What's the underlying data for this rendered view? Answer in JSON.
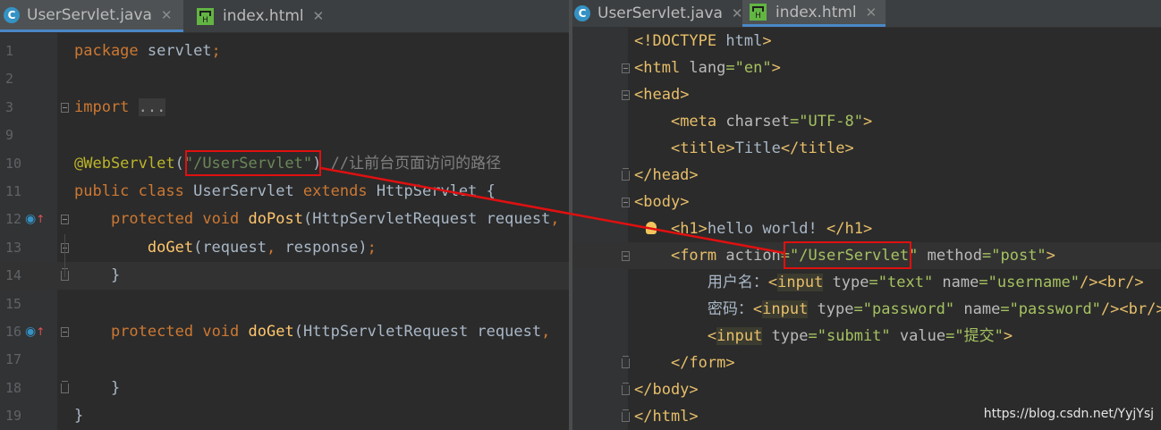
{
  "left": {
    "tabs": [
      {
        "label": "UserServlet.java",
        "icon": "java-class-icon",
        "active": true
      },
      {
        "label": "index.html",
        "icon": "html-file-icon",
        "active": false
      }
    ],
    "lines": [
      {
        "n": "1",
        "code": "package servlet;"
      },
      {
        "n": "2",
        "code": ""
      },
      {
        "n": "3",
        "code": "import ..."
      },
      {
        "n": "9",
        "code": ""
      },
      {
        "n": "10",
        "code": "@WebServlet(\"/UserServlet\") //让前台页面访问的路径"
      },
      {
        "n": "11",
        "code": "public class UserServlet extends HttpServlet {"
      },
      {
        "n": "12",
        "code": "    protected void doPost(HttpServletRequest request,"
      },
      {
        "n": "13",
        "code": "        doGet(request, response);"
      },
      {
        "n": "14",
        "code": "    }"
      },
      {
        "n": "15",
        "code": ""
      },
      {
        "n": "16",
        "code": "    protected void doGet(HttpServletRequest request,"
      },
      {
        "n": "17",
        "code": ""
      },
      {
        "n": "18",
        "code": "    }"
      },
      {
        "n": "19",
        "code": "}"
      }
    ],
    "highlight_text": "\"/UserServlet\""
  },
  "right": {
    "tabs": [
      {
        "label": "UserServlet.java",
        "icon": "java-class-icon",
        "active": false
      },
      {
        "label": "index.html",
        "icon": "html-file-icon",
        "active": true
      }
    ],
    "lines": [
      "<!DOCTYPE html>",
      "<html lang=\"en\">",
      "<head>",
      "    <meta charset=\"UTF-8\">",
      "    <title>Title</title>",
      "</head>",
      "<body>",
      "    <h1>hello world! </h1>",
      "    <form action=\"/UserServlet\" method=\"post\">",
      "        用户名：<input type=\"text\" name=\"username\"/><br/>",
      "        密码：<input type=\"password\" name=\"password\"/><br/>",
      "        <input type=\"submit\" value=\"提交\">",
      "    </form>",
      "</body>",
      "</html>"
    ],
    "highlight_text": "\"/UserServlet\""
  },
  "watermark": "https://blog.csdn.net/YyjYsj",
  "colors": {
    "keyword": "#cc7832",
    "string": "#6a8759",
    "annotation": "#bbb529",
    "comment": "#808080",
    "tag": "#e8bf6a",
    "attr_value": "#a5c261",
    "callout": "#e01010"
  }
}
